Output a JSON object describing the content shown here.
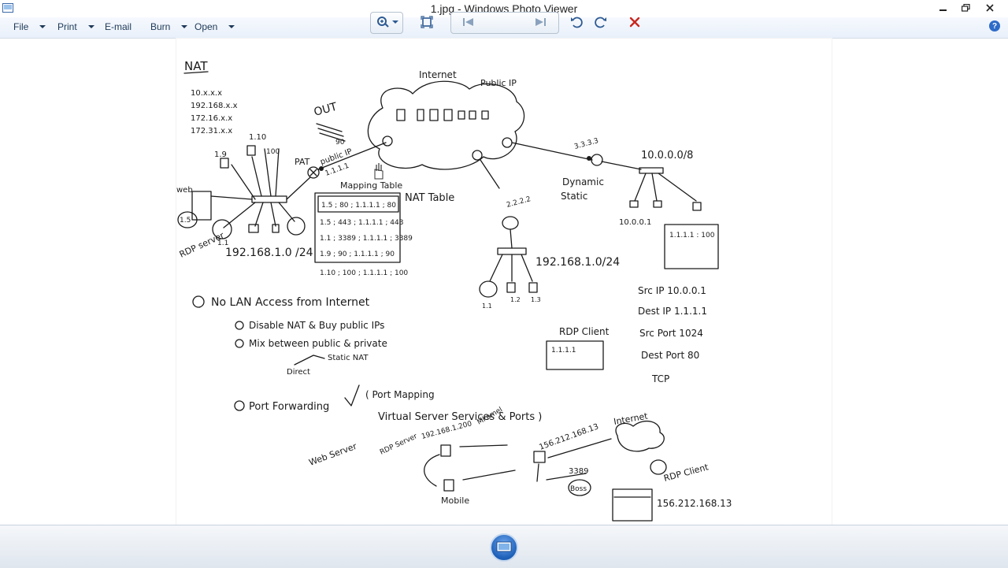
{
  "window": {
    "title": "1.jpg - Windows Photo Viewer",
    "minimize_icon": "minimize-icon",
    "maximize_icon": "restore-icon",
    "close_icon": "close-icon"
  },
  "menu": {
    "items": [
      {
        "label": "File",
        "dropdown": true
      },
      {
        "label": "Print",
        "dropdown": true
      },
      {
        "label": "E-mail",
        "dropdown": false
      },
      {
        "label": "Burn",
        "dropdown": true
      },
      {
        "label": "Open",
        "dropdown": true
      }
    ],
    "help_label": "?"
  },
  "image": {
    "nat_title": "NAT",
    "private_ranges": [
      "10.x.x.x",
      "192.168.x.x",
      "172.16.x.x",
      "172.31.x.x"
    ],
    "internet_label": "Internet",
    "public_ip_label": "Public IP",
    "out_label": "OUT",
    "pat_label": "PAT",
    "router_public_ip": "public IP",
    "router_ip": "1.1.1.1",
    "mapping_table_label": "Mapping Table",
    "nat_table_label": "NAT Table",
    "mapping_rows": [
      "1.5 ; 80 ; 1.1.1.1 ; 80",
      "1.5 ; 443 ; 1.1.1.1 ; 443",
      "1.1 ; 3389 ; 1.1.1.1 ; 3389",
      "1.9 ; 90 ; 1.1.1.1 ; 90",
      "1.10 ; 100 ; 1.1.1.1 ; 100"
    ],
    "host_labels": {
      "h9": "1.9",
      "h10": "1.10",
      "h100": "100",
      "web": "web",
      "h15": "1.5",
      "h11": "1.1",
      "rdp_server": "RDP server"
    },
    "lan1": "192.168.1.0 /24",
    "lan2": "192.168.1.0/24",
    "lan2_router_ip": "2.2.2.2",
    "lan2_hosts": [
      "1.1",
      "1.2",
      "1.3"
    ],
    "router3_ip": "3.3.3.3",
    "dynamic_label": "Dynamic",
    "static_label": "Static",
    "lan3": "10.0.0.0/8",
    "lan3_host": "10.0.0.1",
    "box_lan3": "1.1.1.1 : 100",
    "src_ip": "Src IP  10.0.0.1",
    "dest_ip": "Dest IP  1.1.1.1",
    "src_port": "Src Port  1024",
    "dest_port": "Dest Port  80",
    "tcp": "TCP",
    "rdp_client": "RDP Client",
    "rdp_client_box": "1.1.1.1",
    "no_lan_access": "No LAN Access from Internet",
    "opt1": "Disable NAT & Buy public IPs",
    "opt2": "Mix between public & private",
    "direct": "Direct",
    "static_nat": "Static NAT",
    "port_forwarding": "Port Forwarding",
    "port_mapping": "( Port Mapping",
    "virtual_server": "Virtual Server  Services & Ports )",
    "web_server": "Web Server",
    "rdp_server2": "RDP Server",
    "ip_200": "192.168.1.200",
    "mkamel": "Mkamel",
    "ip_156": "156.212.168.13",
    "internet2": "Internet",
    "mobile": "Mobile",
    "port_3389": "3389",
    "boss": "Boss",
    "rdp_client2": "RDP Client",
    "ip_156_b": "156.212.168.13"
  },
  "toolbar": {
    "zoom_icon": "zoom-icon",
    "fit_icon": "actual-size-icon",
    "prev_icon": "previous-icon",
    "slideshow_icon": "slideshow-icon",
    "next_icon": "next-icon",
    "rotate_ccw_icon": "rotate-counterclockwise-icon",
    "rotate_cw_icon": "rotate-clockwise-icon",
    "delete_icon": "delete-icon"
  }
}
